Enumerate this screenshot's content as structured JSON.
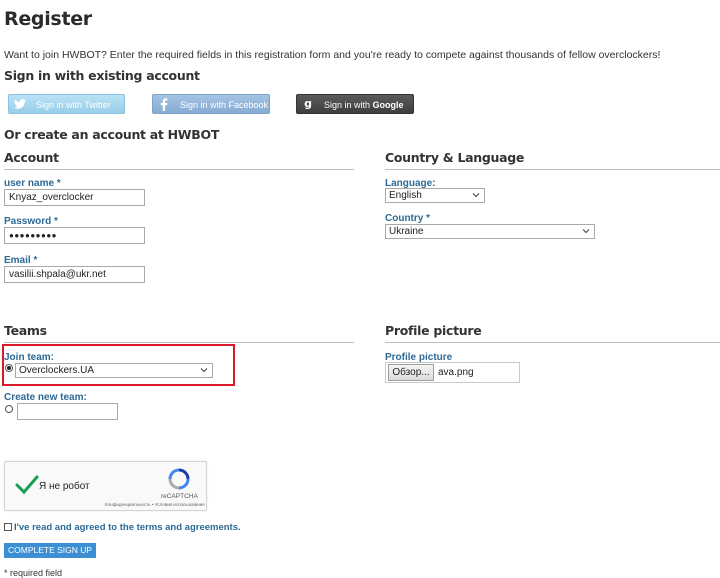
{
  "page": {
    "title": "Register",
    "intro": "Want to join HWBOT? Enter the required fields in this registration form and you're ready to compete against thousands of fellow overclockers!"
  },
  "signin": {
    "heading": "Sign in with existing account",
    "twitter": "Sign in with Twitter",
    "facebook": "Sign in with Facebook",
    "google_prefix": "Sign in with ",
    "google_brand": "Google",
    "colors": {
      "twitter": "#9fd3ee",
      "facebook": "#8fb5d9",
      "google": "#4a4a4a"
    }
  },
  "create": {
    "heading": "Or create an account at HWBOT"
  },
  "account": {
    "heading": "Account",
    "username": {
      "label": "user name *",
      "value": "Knyaz_overclocker"
    },
    "password": {
      "label": "Password *",
      "value": "●●●●●●●●●"
    },
    "email": {
      "label": "Email *",
      "value": "vasilii.shpala@ukr.net"
    }
  },
  "country_language": {
    "heading": "Country & Language",
    "language": {
      "label": "Language:",
      "value": "English"
    },
    "country": {
      "label": "Country *",
      "value": "Ukraine"
    }
  },
  "teams": {
    "heading": "Teams",
    "join": {
      "label": "Join team:",
      "value": "Overclockers.UA",
      "selected": true
    },
    "create": {
      "label": "Create new team:",
      "value": ""
    }
  },
  "profile_picture": {
    "heading": "Profile picture",
    "label": "Profile picture",
    "browse_button": "Обзор...",
    "file_name": "ava.png"
  },
  "recaptcha": {
    "text": "Я не робот",
    "brand": "reCAPTCHA",
    "footer": "Конфиденциальность • Условия использования",
    "checked": true
  },
  "terms": {
    "label": "I've read and agreed to the terms and agreements."
  },
  "submit": {
    "label": "COMPLETE SIGN UP"
  },
  "footer": {
    "required_note": "* required field"
  },
  "highlight": {
    "color": "#d8192a"
  }
}
